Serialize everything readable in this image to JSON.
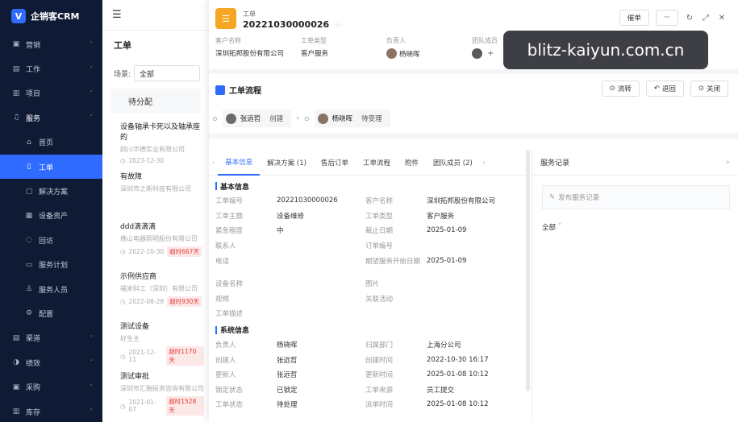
{
  "brand": {
    "logo": "V",
    "name": "企销客CRM"
  },
  "sidebar": {
    "items": [
      {
        "icon": "sales-icon",
        "glyph": "▣",
        "label": "营销",
        "chevron": "˅"
      },
      {
        "icon": "work-icon",
        "glyph": "▤",
        "label": "工作",
        "chevron": "˅"
      },
      {
        "icon": "project-icon",
        "glyph": "▥",
        "label": "项目",
        "chevron": "˅"
      },
      {
        "icon": "service-icon",
        "glyph": "♫",
        "label": "服务",
        "chevron": "˄"
      }
    ],
    "sub_items": [
      {
        "icon": "home-icon",
        "glyph": "⌂",
        "label": "首页"
      },
      {
        "icon": "ticket-icon",
        "glyph": "▯",
        "label": "工单"
      },
      {
        "icon": "solution-icon",
        "glyph": "▢",
        "label": "解决方案"
      },
      {
        "icon": "asset-icon",
        "glyph": "▦",
        "label": "设备资产"
      },
      {
        "icon": "visit-icon",
        "glyph": "◌",
        "label": "回访"
      },
      {
        "icon": "plan-icon",
        "glyph": "▭",
        "label": "服务计划"
      },
      {
        "icon": "staff-icon",
        "glyph": "♙",
        "label": "服务人员"
      },
      {
        "icon": "config-icon",
        "glyph": "⚙",
        "label": "配置"
      }
    ],
    "bottom_items": [
      {
        "icon": "channel-icon",
        "glyph": "▤",
        "label": "渠道",
        "chevron": "˅"
      },
      {
        "icon": "performance-icon",
        "glyph": "◑",
        "label": "绩效",
        "chevron": "˅"
      },
      {
        "icon": "purchase-icon",
        "glyph": "▣",
        "label": "采购",
        "chevron": "˅"
      },
      {
        "icon": "inventory-icon",
        "glyph": "▥",
        "label": "库存",
        "chevron": "˅"
      }
    ]
  },
  "list": {
    "title": "工单",
    "scene_label": "场景:",
    "scene_value": "全部",
    "group": "待分配",
    "cards": [
      {
        "title": "设备轴承卡死以及轴承座的",
        "sub": "四川华德实业有限公司",
        "date": "2023-12-30",
        "overdue": ""
      },
      {
        "title": "有故障",
        "sub": "深圳市之新科技有限公司",
        "date": "",
        "overdue": ""
      },
      {
        "title": "ddd滴滴滴",
        "sub": "佛山电器照明股份有限公司",
        "date": "2022-10-30",
        "overdue": "超时667天"
      },
      {
        "title": "示例供应商",
        "sub": "福米科工（深圳）有限公司",
        "date": "2022-08-28",
        "overdue": "超时930天"
      },
      {
        "title": "测试设备",
        "sub": "好生主",
        "date": "2021-12-11",
        "overdue": "超时1170天"
      },
      {
        "title": "测试审批",
        "sub": "深圳市汇融投资咨询有限公司",
        "date": "2021-01-07",
        "overdue": "超时1528天"
      }
    ]
  },
  "detail": {
    "icon_glyph": "☰",
    "label": "工单",
    "number": "20221030000026",
    "star": "☆",
    "actions": {
      "button_label": "催单",
      "more": "···",
      "refresh": "↻",
      "expand": "⤢",
      "close": "✕"
    },
    "fields": [
      {
        "label": "客户名称",
        "value": "深圳拓邦股份有限公司"
      },
      {
        "label": "工单类型",
        "value": "客户服务"
      },
      {
        "label": "负责人",
        "value": "杨晓晖"
      },
      {
        "label": "团队成员",
        "value": "+"
      }
    ]
  },
  "flow": {
    "title": "工单流程",
    "buttons": [
      {
        "icon": "⊙",
        "label": "流转"
      },
      {
        "icon": "↶",
        "label": "退回"
      },
      {
        "icon": "⊙",
        "label": "关闭"
      }
    ],
    "steps": [
      {
        "name": "张远哲",
        "action": "创建"
      },
      {
        "name": "杨晓晖",
        "action": "待受理"
      }
    ]
  },
  "tabs": [
    "基本信息",
    "解决方案 (1)",
    "售后订单",
    "工单流程",
    "附件",
    "团队成员 (2)"
  ],
  "info": {
    "basic_title": "基本信息",
    "basic_rows": [
      [
        "工单编号",
        "20221030000026",
        "客户名称",
        "深圳拓邦股份有限公司"
      ],
      [
        "工单主题",
        "设备维修",
        "工单类型",
        "客户服务"
      ],
      [
        "紧急程度",
        "中",
        "截止日期",
        "2025-01-09"
      ],
      [
        "联系人",
        "",
        "订单编号",
        ""
      ],
      [
        "电话",
        "",
        "期望服务开始日期",
        "2025-01-09"
      ],
      [
        "",
        "",
        "",
        ""
      ],
      [
        "设备名称",
        "",
        "图片",
        ""
      ],
      [
        "视频",
        "",
        "关联活动",
        ""
      ],
      [
        "工单描述",
        "",
        "",
        ""
      ]
    ],
    "system_title": "系统信息",
    "system_rows": [
      [
        "负责人",
        "杨晓晖",
        "归属部门",
        "上海分公司"
      ],
      [
        "创建人",
        "张远哲",
        "创建时间",
        "2022-10-30 16:17"
      ],
      [
        "更新人",
        "张远哲",
        "更新时间",
        "2025-01-08 10:12"
      ],
      [
        "锁定状态",
        "已锁定",
        "工单来源",
        "员工提交"
      ],
      [
        "工单状态",
        "待处理",
        "派单时间",
        "2025-01-08 10:12"
      ]
    ]
  },
  "side": {
    "title": "服务记录",
    "collapse": "»",
    "post_placeholder": "发布服务记录",
    "filter": "全部"
  },
  "watermark": "blitz-kaiyun.com.cn"
}
